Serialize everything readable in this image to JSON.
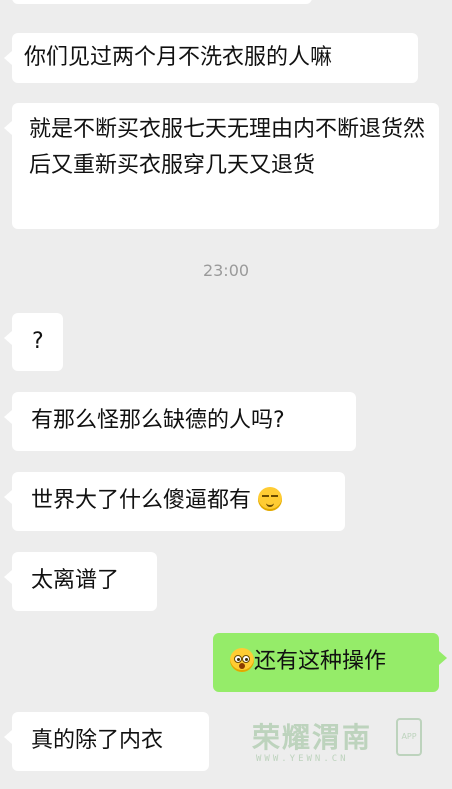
{
  "messages": [
    {
      "side": "left",
      "text": "你们见过两个月不洗衣服的人嘛"
    },
    {
      "side": "left",
      "text": "就是不断买衣服七天无理由内不断退货然后又重新买衣服穿几天又退货"
    },
    {
      "side": "left",
      "text": "?"
    },
    {
      "side": "left",
      "text": "有那么怪那么缺德的人吗?"
    },
    {
      "side": "left",
      "text": "世界大了什么傻逼都有",
      "emoji_after": "unamused-face-icon"
    },
    {
      "side": "left",
      "text": "太离谱了"
    },
    {
      "side": "right",
      "text": "还有这种操作",
      "emoji_before": "flushed-face-icon"
    },
    {
      "side": "left",
      "text": "真的除了内衣"
    }
  ],
  "timestamp": "23:00",
  "watermark": {
    "text": "荣耀渭南",
    "app": "APP",
    "url": "WWW.YEWN.CN"
  },
  "colors": {
    "background": "#ededed",
    "incoming_bubble": "#ffffff",
    "outgoing_bubble": "#95ec69",
    "timestamp": "#9a9a9a"
  }
}
